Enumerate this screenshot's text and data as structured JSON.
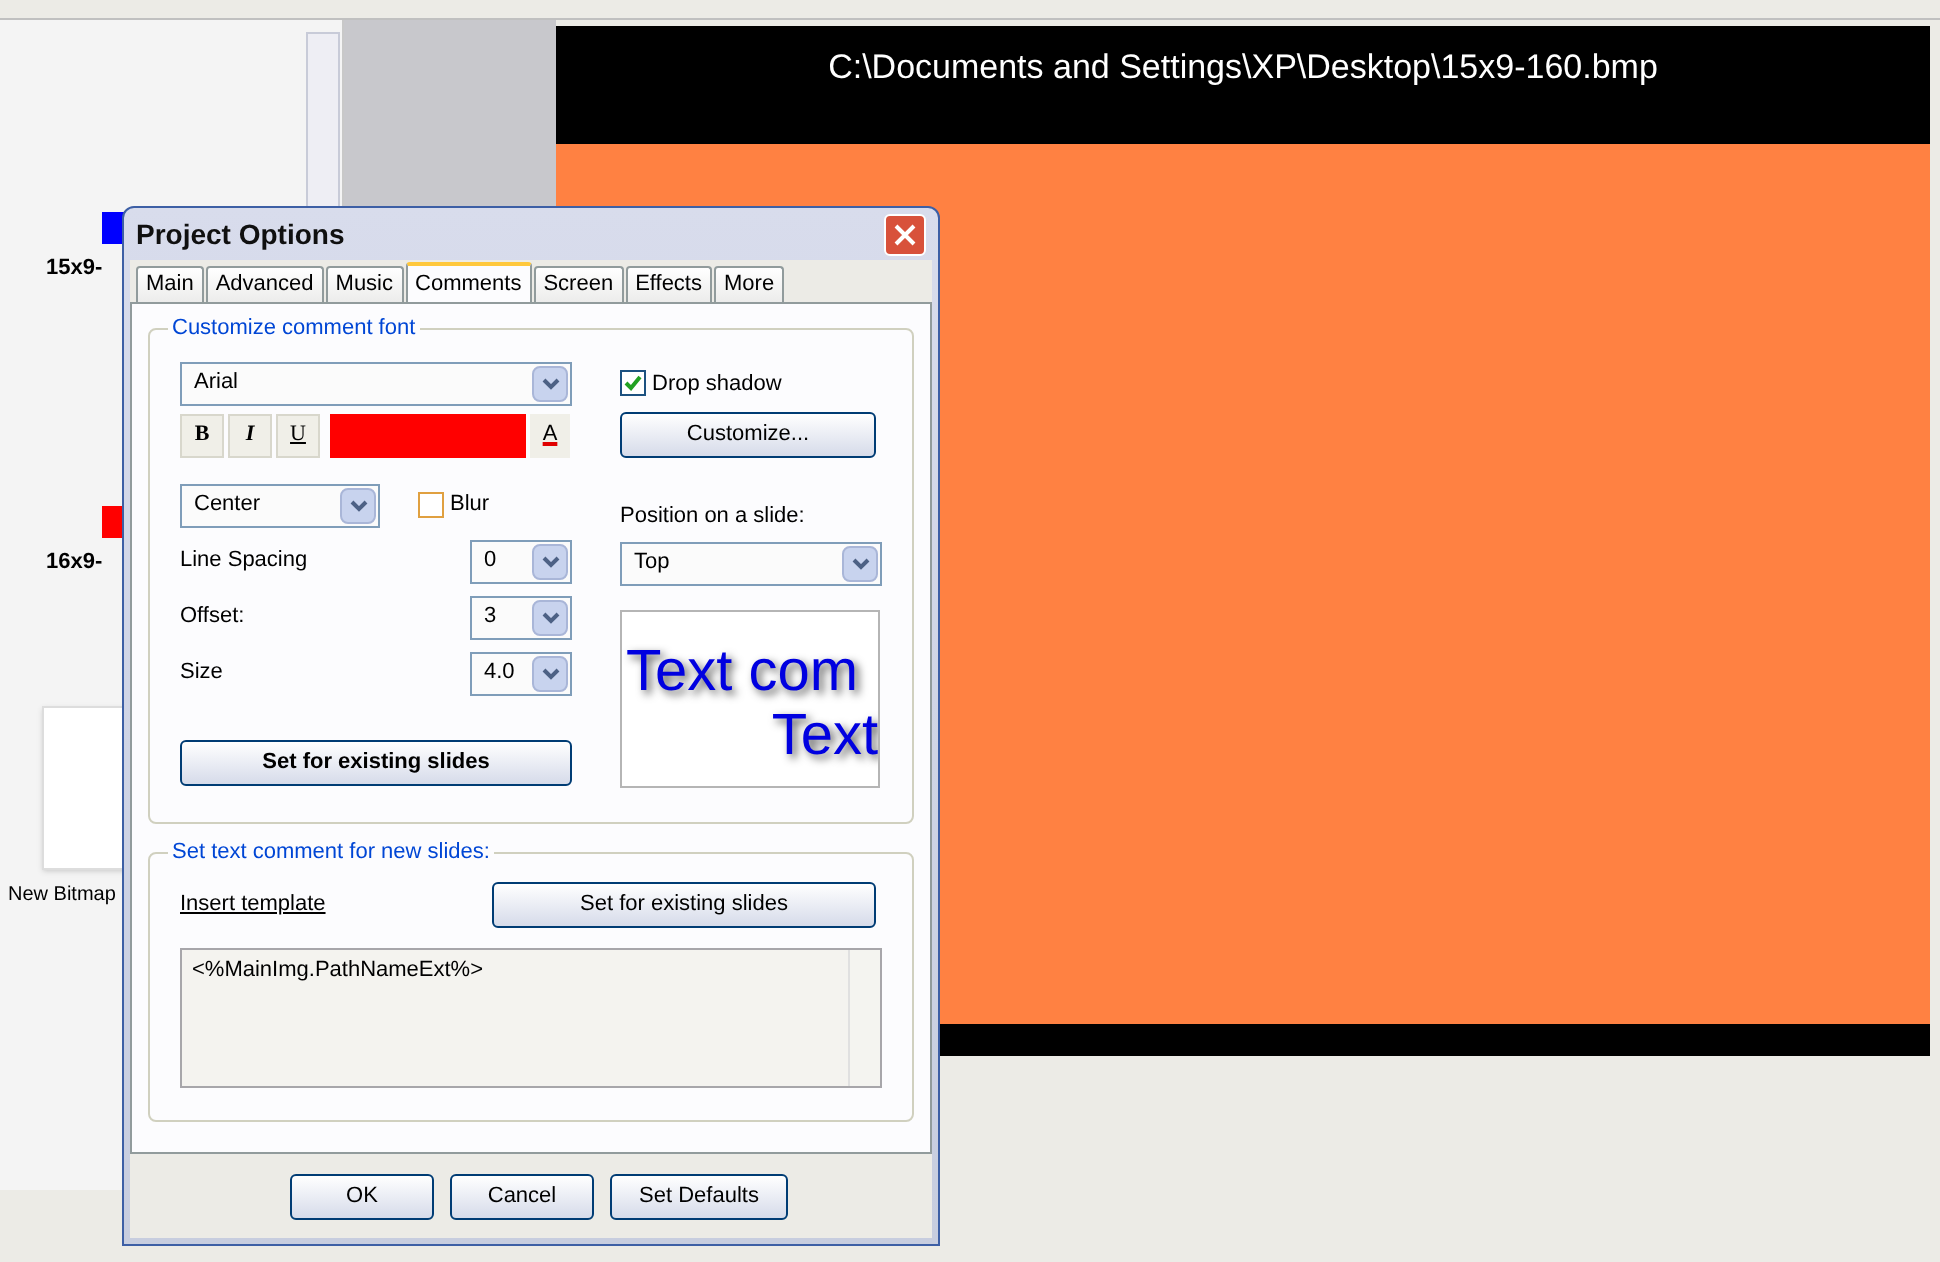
{
  "left_panel": {
    "thumbnails": [
      {
        "label": "15x9-",
        "color": "#0000ff",
        "kind": "swatch"
      },
      {
        "label": "16x9-",
        "color": "#ff0000",
        "kind": "swatch"
      },
      {
        "label": "New Bitmap",
        "kind": "screenshot"
      }
    ]
  },
  "preview": {
    "title": "C:\\Documents and Settings\\XP\\Desktop\\15x9-160.bmp"
  },
  "dialog": {
    "title": "Project Options",
    "tabs": [
      {
        "label": "Main",
        "selected": false
      },
      {
        "label": "Advanced",
        "selected": false
      },
      {
        "label": "Music",
        "selected": false
      },
      {
        "label": "Comments",
        "selected": true
      },
      {
        "label": "Screen",
        "selected": false
      },
      {
        "label": "Effects",
        "selected": false
      },
      {
        "label": "More",
        "selected": false
      }
    ],
    "font_group": {
      "legend": "Customize comment font",
      "font": "Arial",
      "style_buttons": [
        "B",
        "I",
        "U"
      ],
      "color": "#ff0000",
      "font_color_button": "A",
      "alignment": "Center",
      "blur": {
        "label": "Blur",
        "checked": false
      },
      "rows": [
        {
          "label": "Line Spacing",
          "value": "0"
        },
        {
          "label": "Offset:",
          "value": "3"
        },
        {
          "label": "Size",
          "value": "4.0"
        }
      ],
      "apply_button": "Set for existing slides",
      "drop_shadow": {
        "label": "Drop shadow",
        "checked": true
      },
      "customize_button": "Customize...",
      "position_label": "Position on a slide:",
      "position": "Top",
      "sample_lines": [
        "Text com",
        "Text"
      ]
    },
    "comment_group": {
      "legend": "Set text comment for new slides:",
      "insert_link": "Insert template",
      "apply_button": "Set for existing slides",
      "text": "<%MainImg.PathNameExt%>"
    },
    "buttons": [
      "OK",
      "Cancel",
      "Set Defaults"
    ]
  }
}
